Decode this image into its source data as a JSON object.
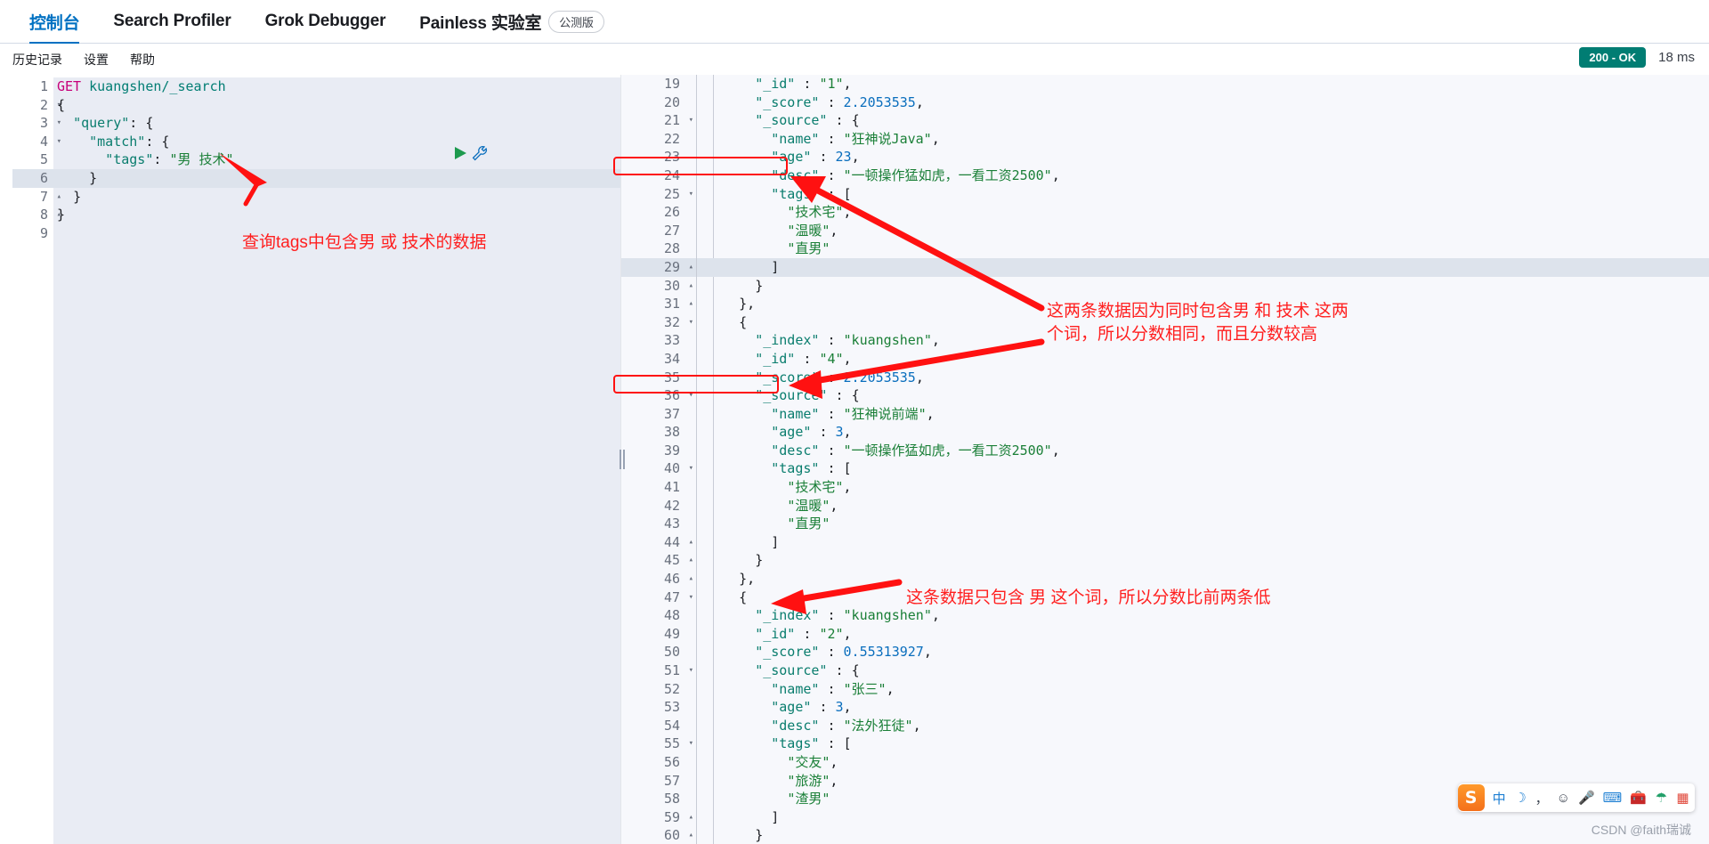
{
  "topnav": {
    "items": [
      {
        "label": "控制台",
        "active": true
      },
      {
        "label": "Search Profiler",
        "active": false
      },
      {
        "label": "Grok Debugger",
        "active": false
      },
      {
        "label": "Painless 实验室",
        "active": false,
        "badge": "公测版"
      }
    ]
  },
  "subbar": {
    "items": [
      {
        "label": "历史记录"
      },
      {
        "label": "设置"
      },
      {
        "label": "帮助"
      }
    ],
    "status_code": "200 - OK",
    "status_color": "#017d73",
    "elapsed": "18 ms"
  },
  "request_editor": {
    "lines": [
      {
        "n": "1",
        "fold": "",
        "text": "GET kuangshen/_search",
        "type": "request"
      },
      {
        "n": "2",
        "fold": "▾",
        "text": "{"
      },
      {
        "n": "3",
        "fold": "▾",
        "text": "  \"query\": {"
      },
      {
        "n": "4",
        "fold": "▾",
        "text": "    \"match\": {"
      },
      {
        "n": "5",
        "fold": "",
        "text": "      \"tags\": \"男 技术\""
      },
      {
        "n": "6",
        "fold": "▴",
        "text": "    }",
        "highlight": true
      },
      {
        "n": "7",
        "fold": "▴",
        "text": "  }"
      },
      {
        "n": "8",
        "fold": "▴",
        "text": "}"
      },
      {
        "n": "9",
        "fold": "",
        "text": ""
      }
    ],
    "method": "GET",
    "path": "kuangshen/_search",
    "run_icon": "play-triangle-icon",
    "wrench_icon": "wrench-icon"
  },
  "response_viewer": {
    "lines": [
      {
        "n": "19",
        "fold": "",
        "text": "      \"_id\" : \"1\","
      },
      {
        "n": "20",
        "fold": "",
        "text": "      \"_score\" : 2.2053535,"
      },
      {
        "n": "21",
        "fold": "▾",
        "text": "      \"_source\" : {"
      },
      {
        "n": "22",
        "fold": "",
        "text": "        \"name\" : \"狂神说Java\","
      },
      {
        "n": "23",
        "fold": "",
        "text": "        \"age\" : 23,"
      },
      {
        "n": "24",
        "fold": "",
        "text": "        \"desc\" : \"一顿操作猛如虎，一看工资2500\","
      },
      {
        "n": "25",
        "fold": "▾",
        "text": "        \"tags\" : ["
      },
      {
        "n": "26",
        "fold": "",
        "text": "          \"技术宅\","
      },
      {
        "n": "27",
        "fold": "",
        "text": "          \"温暖\","
      },
      {
        "n": "28",
        "fold": "",
        "text": "          \"直男\""
      },
      {
        "n": "29",
        "fold": "▴",
        "text": "        ]",
        "highlight": true
      },
      {
        "n": "30",
        "fold": "▴",
        "text": "      }"
      },
      {
        "n": "31",
        "fold": "▴",
        "text": "    },"
      },
      {
        "n": "32",
        "fold": "▾",
        "text": "    {"
      },
      {
        "n": "33",
        "fold": "",
        "text": "      \"_index\" : \"kuangshen\","
      },
      {
        "n": "34",
        "fold": "",
        "text": "      \"_id\" : \"4\","
      },
      {
        "n": "35",
        "fold": "",
        "text": "      \"_score\" : 2.2053535,"
      },
      {
        "n": "36",
        "fold": "▾",
        "text": "      \"_source\" : {"
      },
      {
        "n": "37",
        "fold": "",
        "text": "        \"name\" : \"狂神说前端\","
      },
      {
        "n": "38",
        "fold": "",
        "text": "        \"age\" : 3,"
      },
      {
        "n": "39",
        "fold": "",
        "text": "        \"desc\" : \"一顿操作猛如虎，一看工资2500\","
      },
      {
        "n": "40",
        "fold": "▾",
        "text": "        \"tags\" : ["
      },
      {
        "n": "41",
        "fold": "",
        "text": "          \"技术宅\","
      },
      {
        "n": "42",
        "fold": "",
        "text": "          \"温暖\","
      },
      {
        "n": "43",
        "fold": "",
        "text": "          \"直男\""
      },
      {
        "n": "44",
        "fold": "▴",
        "text": "        ]"
      },
      {
        "n": "45",
        "fold": "▴",
        "text": "      }"
      },
      {
        "n": "46",
        "fold": "▴",
        "text": "    },"
      },
      {
        "n": "47",
        "fold": "▾",
        "text": "    {"
      },
      {
        "n": "48",
        "fold": "",
        "text": "      \"_index\" : \"kuangshen\","
      },
      {
        "n": "49",
        "fold": "",
        "text": "      \"_id\" : \"2\","
      },
      {
        "n": "50",
        "fold": "",
        "text": "      \"_score\" : 0.55313927,"
      },
      {
        "n": "51",
        "fold": "▾",
        "text": "      \"_source\" : {"
      },
      {
        "n": "52",
        "fold": "",
        "text": "        \"name\" : \"张三\","
      },
      {
        "n": "53",
        "fold": "",
        "text": "        \"age\" : 3,"
      },
      {
        "n": "54",
        "fold": "",
        "text": "        \"desc\" : \"法外狂徒\","
      },
      {
        "n": "55",
        "fold": "▾",
        "text": "        \"tags\" : ["
      },
      {
        "n": "56",
        "fold": "",
        "text": "          \"交友\","
      },
      {
        "n": "57",
        "fold": "",
        "text": "          \"旅游\","
      },
      {
        "n": "58",
        "fold": "",
        "text": "          \"渣男\""
      },
      {
        "n": "59",
        "fold": "▴",
        "text": "        ]"
      },
      {
        "n": "60",
        "fold": "▴",
        "text": "      }"
      }
    ]
  },
  "annotations": {
    "left_note": "查询tags中包含男 或 技术的数据",
    "right_note_line1": "这两条数据因为同时包含男 和 技术 这两",
    "right_note_line2": "个词，所以分数相同，而且分数较高",
    "bottom_note": "这条数据只包含 男 这个词，所以分数比前两条低",
    "color": "#ff1f1f"
  },
  "ime": {
    "logo_text": "S",
    "items": [
      {
        "icon": "chinese-mode-icon",
        "glyph": "中",
        "color": "blue"
      },
      {
        "icon": "moon-icon",
        "glyph": "☽",
        "color": "blue"
      },
      {
        "icon": "comma-period-icon",
        "glyph": "，",
        "color": "plain"
      },
      {
        "icon": "smiley-icon",
        "glyph": "☺",
        "color": "plain"
      },
      {
        "icon": "microphone-icon",
        "glyph": "🎤",
        "color": "plain"
      },
      {
        "icon": "keyboard-icon",
        "glyph": "⌨",
        "color": "blue"
      },
      {
        "icon": "toolbox-icon",
        "glyph": "🧰",
        "color": "plain"
      },
      {
        "icon": "umbrella-icon",
        "glyph": "☂",
        "color": "green"
      },
      {
        "icon": "grid-apps-icon",
        "glyph": "▦",
        "color": "red"
      }
    ]
  },
  "watermark": "CSDN @faith瑞诚"
}
